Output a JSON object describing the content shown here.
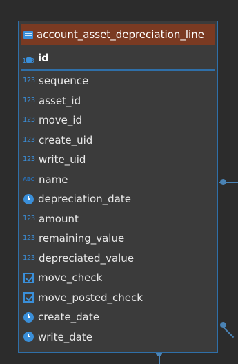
{
  "entity": {
    "title": "account_asset_depreciation_line",
    "primary_key": {
      "type_icon": "number-key-icon",
      "label": "id"
    },
    "fields": [
      {
        "label": "sequence",
        "type": "number"
      },
      {
        "label": "asset_id",
        "type": "number"
      },
      {
        "label": "move_id",
        "type": "number"
      },
      {
        "label": "create_uid",
        "type": "number"
      },
      {
        "label": "write_uid",
        "type": "number"
      },
      {
        "label": "name",
        "type": "text"
      },
      {
        "label": "depreciation_date",
        "type": "date"
      },
      {
        "label": "amount",
        "type": "number"
      },
      {
        "label": "remaining_value",
        "type": "number"
      },
      {
        "label": "depreciated_value",
        "type": "number"
      },
      {
        "label": "move_check",
        "type": "boolean"
      },
      {
        "label": "move_posted_check",
        "type": "boolean"
      },
      {
        "label": "create_date",
        "type": "date"
      },
      {
        "label": "write_date",
        "type": "date"
      }
    ],
    "icon_text": {
      "number": "123",
      "text": "ABC"
    }
  },
  "colors": {
    "title_bar": "#7a3a22",
    "border": "#2f6fa8",
    "icon_blue": "#3a8fd9",
    "card_bg": "#3b3b3b"
  }
}
